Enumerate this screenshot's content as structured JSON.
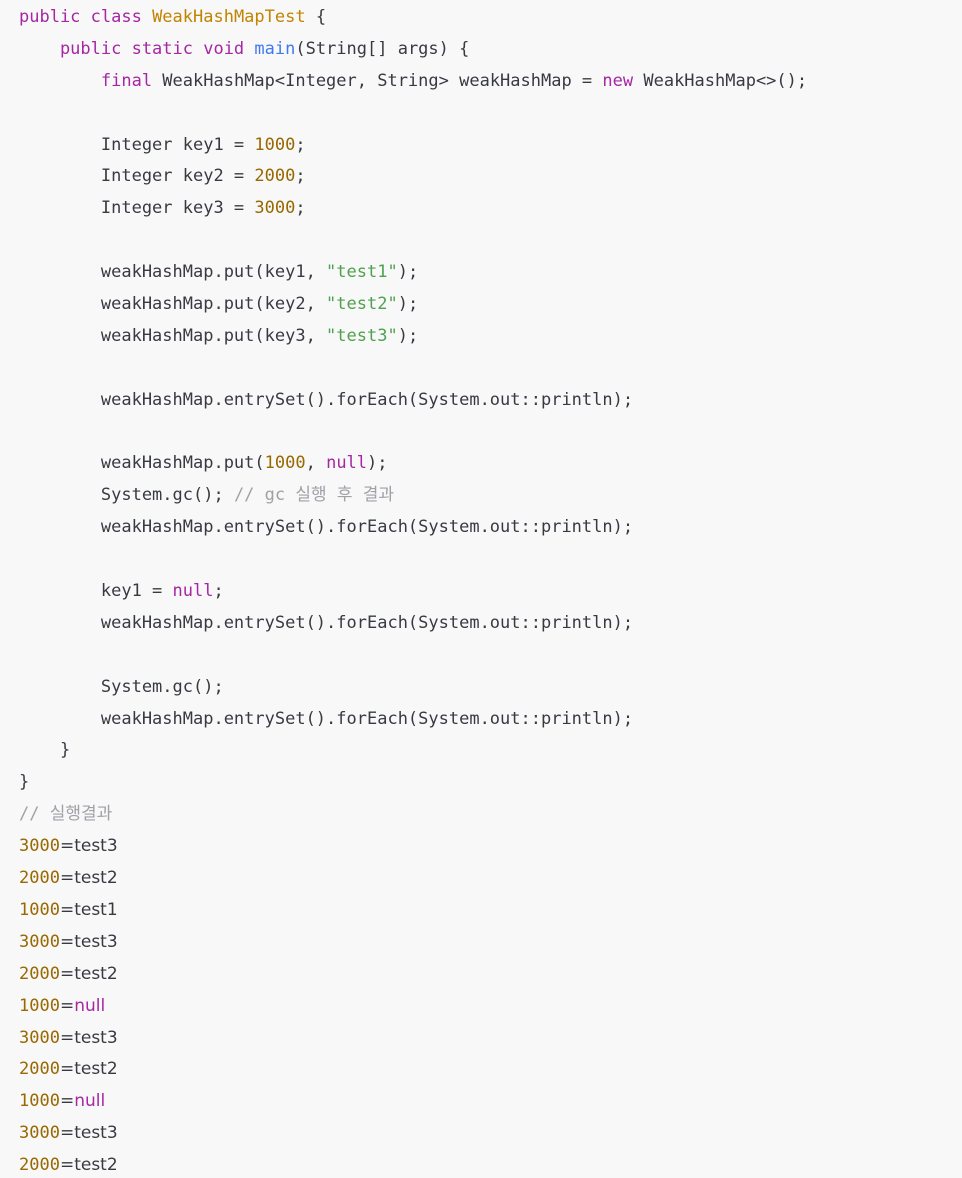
{
  "code_lines": [
    [
      {
        "t": "public class ",
        "c": "kw"
      },
      {
        "t": "WeakHashMapTest",
        "c": "cls"
      },
      {
        "t": " {",
        "c": "plain"
      }
    ],
    [
      {
        "t": "    public static void ",
        "c": "kw"
      },
      {
        "t": "main",
        "c": "fn"
      },
      {
        "t": "(String[] args) {",
        "c": "plain"
      }
    ],
    [
      {
        "t": "        final ",
        "c": "kw"
      },
      {
        "t": "WeakHashMap<Integer, String> weakHashMap = ",
        "c": "plain"
      },
      {
        "t": "new",
        "c": "kw"
      },
      {
        "t": " WeakHashMap<>();",
        "c": "plain"
      }
    ],
    [],
    [
      {
        "t": "        Integer key1 = ",
        "c": "plain"
      },
      {
        "t": "1000",
        "c": "num"
      },
      {
        "t": ";",
        "c": "plain"
      }
    ],
    [
      {
        "t": "        Integer key2 = ",
        "c": "plain"
      },
      {
        "t": "2000",
        "c": "num"
      },
      {
        "t": ";",
        "c": "plain"
      }
    ],
    [
      {
        "t": "        Integer key3 = ",
        "c": "plain"
      },
      {
        "t": "3000",
        "c": "num"
      },
      {
        "t": ";",
        "c": "plain"
      }
    ],
    [],
    [
      {
        "t": "        weakHashMap.put(key1, ",
        "c": "plain"
      },
      {
        "t": "\"test1\"",
        "c": "str"
      },
      {
        "t": ");",
        "c": "plain"
      }
    ],
    [
      {
        "t": "        weakHashMap.put(key2, ",
        "c": "plain"
      },
      {
        "t": "\"test2\"",
        "c": "str"
      },
      {
        "t": ");",
        "c": "plain"
      }
    ],
    [
      {
        "t": "        weakHashMap.put(key3, ",
        "c": "plain"
      },
      {
        "t": "\"test3\"",
        "c": "str"
      },
      {
        "t": ");",
        "c": "plain"
      }
    ],
    [],
    [
      {
        "t": "        weakHashMap.entrySet().forEach(System.out::println);",
        "c": "plain"
      }
    ],
    [],
    [
      {
        "t": "        weakHashMap.put(",
        "c": "plain"
      },
      {
        "t": "1000",
        "c": "num"
      },
      {
        "t": ", ",
        "c": "plain"
      },
      {
        "t": "null",
        "c": "kw"
      },
      {
        "t": ");",
        "c": "plain"
      }
    ],
    [
      {
        "t": "        System.gc(); ",
        "c": "plain"
      },
      {
        "t": "// gc 실행 후 결과",
        "c": "com"
      }
    ],
    [
      {
        "t": "        weakHashMap.entrySet().forEach(System.out::println);",
        "c": "plain"
      }
    ],
    [],
    [
      {
        "t": "        key1 = ",
        "c": "plain"
      },
      {
        "t": "null",
        "c": "kw"
      },
      {
        "t": ";",
        "c": "plain"
      }
    ],
    [
      {
        "t": "        weakHashMap.entrySet().forEach(System.out::println);",
        "c": "plain"
      }
    ],
    [],
    [
      {
        "t": "        System.gc();",
        "c": "plain"
      }
    ],
    [
      {
        "t": "        weakHashMap.entrySet().forEach(System.out::println);",
        "c": "plain"
      }
    ],
    [
      {
        "t": "    }",
        "c": "plain"
      }
    ],
    [
      {
        "t": "}",
        "c": "plain"
      }
    ],
    [
      {
        "t": "// 실행결과",
        "c": "com"
      }
    ],
    [
      {
        "t": "3000",
        "c": "num"
      },
      {
        "t": "=test3",
        "c": "plain",
        "o": 1
      }
    ],
    [
      {
        "t": "2000",
        "c": "num"
      },
      {
        "t": "=test2",
        "c": "plain",
        "o": 1
      }
    ],
    [
      {
        "t": "1000",
        "c": "num"
      },
      {
        "t": "=test1",
        "c": "plain",
        "o": 1
      }
    ],
    [
      {
        "t": "3000",
        "c": "num"
      },
      {
        "t": "=test3",
        "c": "plain",
        "o": 1
      }
    ],
    [
      {
        "t": "2000",
        "c": "num"
      },
      {
        "t": "=test2",
        "c": "plain",
        "o": 1
      }
    ],
    [
      {
        "t": "1000",
        "c": "num"
      },
      {
        "t": "=",
        "c": "plain",
        "o": 1
      },
      {
        "t": "null",
        "c": "kw",
        "o": 1
      }
    ],
    [
      {
        "t": "3000",
        "c": "num"
      },
      {
        "t": "=test3",
        "c": "plain",
        "o": 1
      }
    ],
    [
      {
        "t": "2000",
        "c": "num"
      },
      {
        "t": "=test2",
        "c": "plain",
        "o": 1
      }
    ],
    [
      {
        "t": "1000",
        "c": "num"
      },
      {
        "t": "=",
        "c": "plain",
        "o": 1
      },
      {
        "t": "null",
        "c": "kw",
        "o": 1
      }
    ],
    [
      {
        "t": "3000",
        "c": "num"
      },
      {
        "t": "=test3",
        "c": "plain",
        "o": 1
      }
    ],
    [
      {
        "t": "2000",
        "c": "num"
      },
      {
        "t": "=test2",
        "c": "plain",
        "o": 1
      }
    ]
  ],
  "colors": {
    "background": "#f8f8f8",
    "keyword": "#a626a4",
    "class_name": "#c18401",
    "function": "#4078f2",
    "number": "#986801",
    "string": "#50a14f",
    "comment": "#a0a1a7",
    "text": "#383a42"
  }
}
